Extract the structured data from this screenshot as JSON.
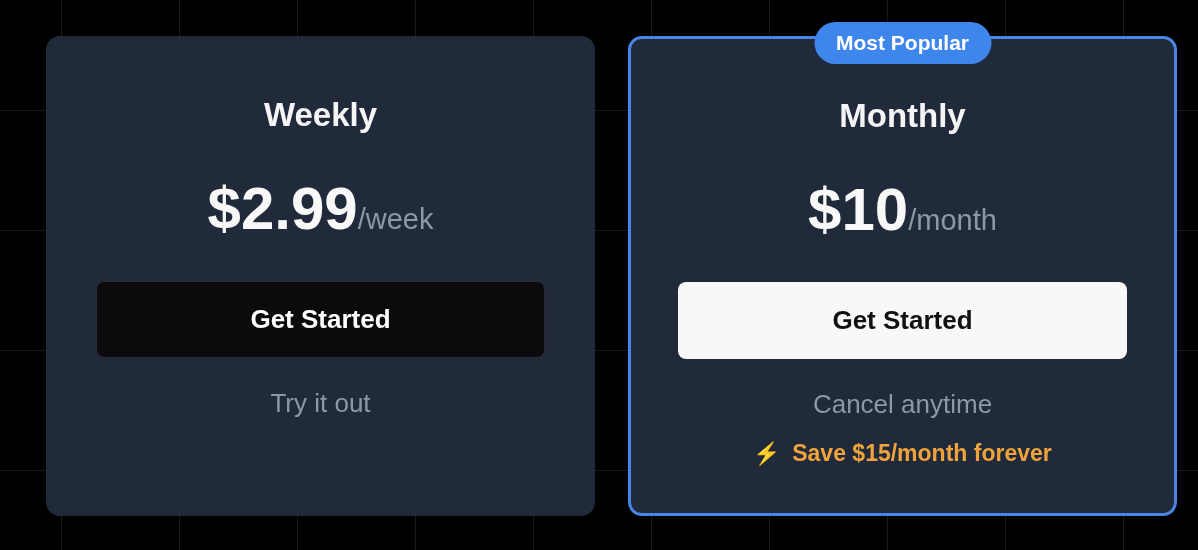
{
  "plans": [
    {
      "name": "Weekly",
      "price": "$2.99",
      "period": "/week",
      "button": "Get Started",
      "note": "Try it out",
      "featured": false
    },
    {
      "name": "Monthly",
      "price": "$10",
      "period": "/month",
      "button": "Get Started",
      "note": "Cancel anytime",
      "featured": true,
      "badge": "Most Popular",
      "promo": {
        "icon": "⚡",
        "text": "Save $15/month forever"
      }
    }
  ]
}
